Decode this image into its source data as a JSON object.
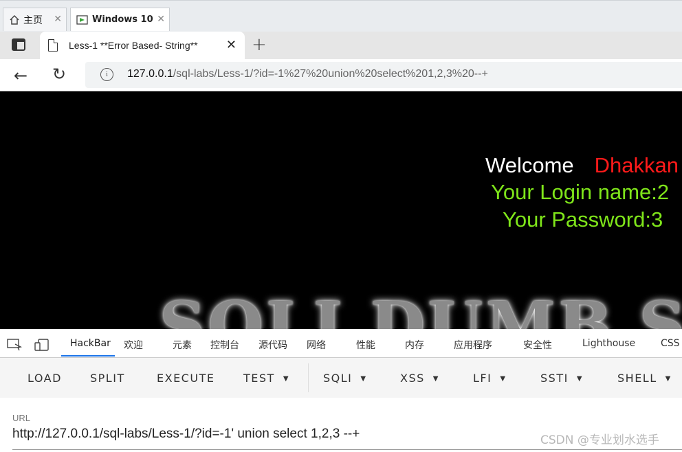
{
  "vm_tabs": [
    {
      "label": "主页",
      "icon": "home-icon"
    },
    {
      "label": "Windows 10",
      "icon": "vm-icon"
    }
  ],
  "browser": {
    "tab_title": "Less-1 **Error Based- String**",
    "url_host": "127.0.0.1",
    "url_path": "/sql-labs/Less-1/?id=-1%27%20union%20select%201,2,3%20--+"
  },
  "page": {
    "welcome": "Welcome",
    "user": "Dhakkan",
    "login_name": "Your Login name:2",
    "password": "Your Password:3",
    "logo_text": "SQLI DUMB S",
    "colors": {
      "welcome": "#ffffff",
      "user": "#ff1a1a",
      "login": "#7fe51a"
    }
  },
  "devtools": {
    "tabs": [
      "HackBar",
      "欢迎",
      "元素",
      "控制台",
      "源代码",
      "网络",
      "性能",
      "内存",
      "应用程序",
      "安全性",
      "Lighthouse",
      "CSS"
    ],
    "active": "HackBar"
  },
  "hackbar": {
    "buttons": [
      "LOAD",
      "SPLIT",
      "EXECUTE",
      "TEST",
      "SQLI",
      "XSS",
      "LFI",
      "SSTI",
      "SHELL"
    ],
    "url_label": "URL",
    "url_value": "http://127.0.0.1/sql-labs/Less-1/?id=-1' union select 1,2,3 --+"
  },
  "watermark": "CSDN @专业划水选手"
}
